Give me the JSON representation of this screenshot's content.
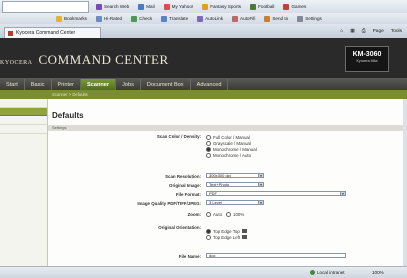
{
  "browser": {
    "toolbar_row1": [
      "Search Web",
      "Mail",
      "My Yahoo!",
      "Fantasy Sports",
      "Football",
      "Games"
    ],
    "toolbar_row2": [
      "Bookmarks",
      "Hi-Rated",
      "Check",
      "Translate",
      "AutoLink",
      "AutoFill",
      "Send to",
      "Settings"
    ],
    "tab_title": "Kyocera Command Center",
    "right_tools": [
      "Page",
      "Tools"
    ],
    "status_zone": "Local intranet",
    "zoom": "100%"
  },
  "app": {
    "brand_prefix": "KYOCERA",
    "brand_title": "COMMAND CENTER",
    "model": "KM-3060",
    "model_sub": "Kyocera Mita",
    "nav": [
      "Start",
      "Basic",
      "Printer",
      "Scanner",
      "Jobs",
      "Document Box",
      "Advanced"
    ],
    "nav_active": 3,
    "breadcrumb": "Scanner > Defaults"
  },
  "page": {
    "title": "Defaults",
    "section": "Settings",
    "color_label": "Scan Color / Density:",
    "color_options": [
      "Full Color / Manual",
      "Grayscale / Manual",
      "Monochrome / Manual",
      "Monochrome / Auto"
    ],
    "color_selected": 2,
    "resolution_label": "Scan Resolution:",
    "resolution_value": "300x300 dpi",
    "orig_image_label": "Original Image:",
    "orig_image_value": "Text+Photo",
    "file_format_label": "File Format:",
    "file_format_value": "PDF",
    "quality_label": "Image Quality PDF/TIFF/JPEG:",
    "quality_value": "3 Level",
    "zoom_label": "Zoom:",
    "zoom_options": [
      "Auto",
      "100%"
    ],
    "orientation_label": "Original Orientation:",
    "orientation_options": [
      "Top Edge Top",
      "Top Edge Left"
    ],
    "filename_label": "File Name:",
    "filename_value": "doc"
  }
}
